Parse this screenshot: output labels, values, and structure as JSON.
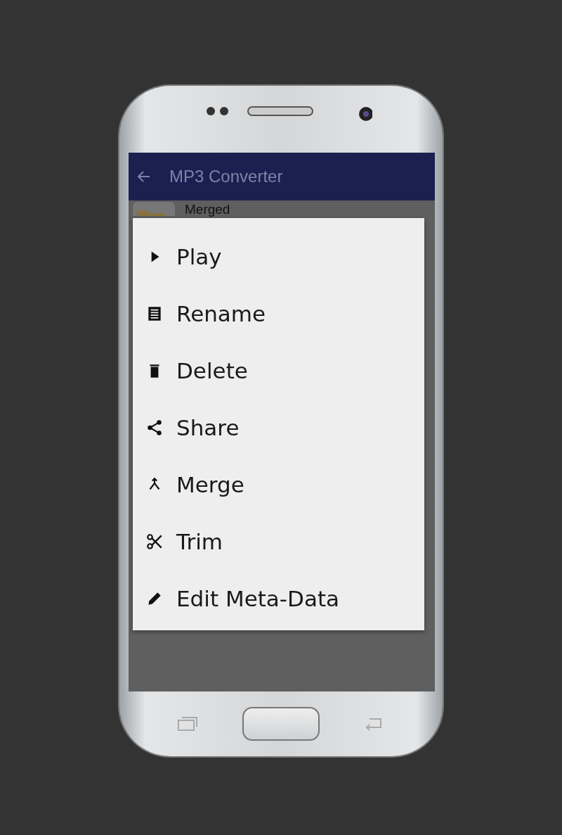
{
  "app_bar": {
    "title": "MP3 Converter"
  },
  "list": [
    {
      "title": "Merged"
    }
  ],
  "menu": {
    "items": [
      {
        "label": "Play"
      },
      {
        "label": "Rename"
      },
      {
        "label": "Delete"
      },
      {
        "label": "Share"
      },
      {
        "label": "Merge"
      },
      {
        "label": "Trim"
      },
      {
        "label": "Edit Meta-Data"
      }
    ]
  }
}
